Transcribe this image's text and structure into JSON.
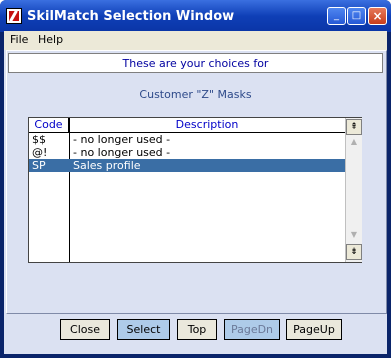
{
  "window": {
    "title": "SkilMatch Selection Window"
  },
  "titlebar_buttons": {
    "minimize": "_",
    "maximize": "□",
    "close": "×"
  },
  "menu": {
    "file": "File",
    "help": "Help"
  },
  "header": {
    "text": "These are your choices for"
  },
  "subtitle": "Customer \"Z\" Masks",
  "table": {
    "columns": [
      "Code",
      "Description"
    ],
    "rows": [
      {
        "code": "$$",
        "description": "- no longer used -"
      },
      {
        "code": "@!",
        "description": " - no longer used -"
      },
      {
        "code": "SP",
        "description": "Sales profile"
      }
    ],
    "selected_row_index": 2
  },
  "scrollbar": {
    "top_label": "⇞",
    "bottom_label": "⇟",
    "up_arrow": "▲",
    "down_arrow": "▼"
  },
  "buttons": {
    "close": "Close",
    "select": "Select",
    "top": "Top",
    "pagedn": "PageDn",
    "pageup": "PageUp"
  },
  "colors": {
    "titlebar": "#0f3fb7",
    "client_bg": "#dbe1f2",
    "selection": "#3a6ea5",
    "header_text": "#0000a0"
  }
}
